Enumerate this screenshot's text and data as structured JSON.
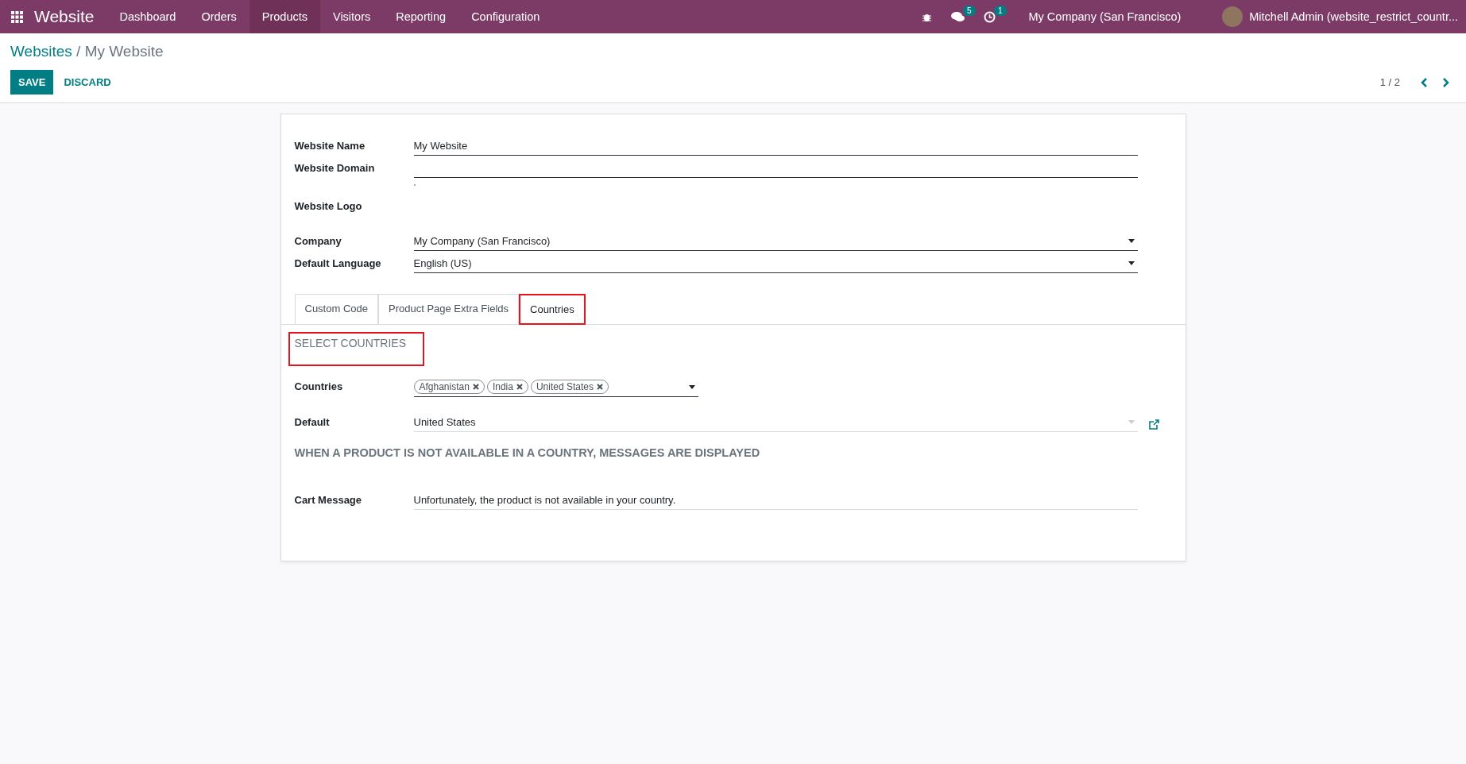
{
  "navbar": {
    "app_name": "Website",
    "menu": [
      {
        "label": "Dashboard",
        "selected": false
      },
      {
        "label": "Orders",
        "selected": false
      },
      {
        "label": "Products",
        "selected": true
      },
      {
        "label": "Visitors",
        "selected": false
      },
      {
        "label": "Reporting",
        "selected": false
      },
      {
        "label": "Configuration",
        "selected": false
      }
    ],
    "systray": [
      {
        "kind": "bug"
      },
      {
        "kind": "chat",
        "badge": "5"
      },
      {
        "kind": "clock",
        "badge": "1"
      }
    ],
    "company": "My Company (San Francisco)",
    "user": "Mitchell Admin (website_restrict_countr..."
  },
  "breadcrumb": {
    "parent": "Websites",
    "separator": "/",
    "current": "My Website"
  },
  "buttons": {
    "save": "SAVE",
    "discard": "DISCARD"
  },
  "pager": {
    "value": "1 / 2"
  },
  "form": {
    "fields": [
      {
        "label": "Website Name",
        "value": "My Website",
        "kind": "text"
      },
      {
        "label": "Website Domain",
        "kind": "text"
      },
      {
        "label": "Website Logo",
        "kind": "image"
      },
      {
        "label": "Company",
        "value": "My Company (San Francisco)",
        "kind": "select"
      },
      {
        "label": "Default Language",
        "value": "English (US)",
        "kind": "select"
      }
    ],
    "tabs": [
      {
        "label": "Custom Code",
        "selected": false,
        "highlighted": false
      },
      {
        "label": "Product Page Extra Fields",
        "selected": false,
        "highlighted": false
      },
      {
        "label": "Countries",
        "selected": true,
        "highlighted": true
      }
    ],
    "section_title": {
      "text": "SELECT COUNTRIES",
      "highlighted": true
    },
    "countries": {
      "label": "Countries",
      "tags": [
        "Afghanistan",
        "India",
        "United States"
      ]
    },
    "default": {
      "label": "Default",
      "value": "United States"
    },
    "message_title": "WHEN A PRODUCT IS NOT AVAILABLE IN A COUNTRY, MESSAGES ARE DISPLAYED",
    "cart_message": {
      "label": "Cart Message",
      "value": "Unfortunately, the product is not available in your country."
    }
  }
}
